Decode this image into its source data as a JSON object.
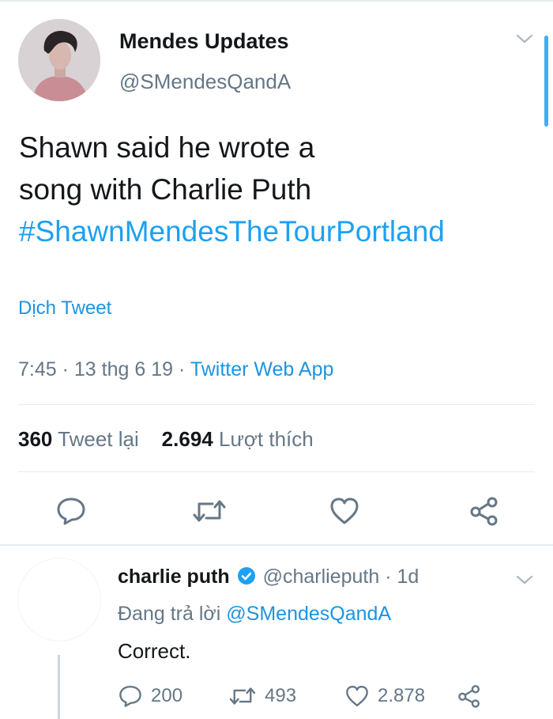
{
  "tweet": {
    "author_name": "Mendes Updates",
    "author_handle": "@SMendesQandA",
    "text_line1": "Shawn said he wrote a",
    "text_line2": "song with Charlie Puth",
    "hashtag": "#ShawnMendesTheTourPortland",
    "translate_label": "Dịch Tweet",
    "time": "7:45",
    "date": "13 thg 6 19",
    "separator": "·",
    "source": "Twitter Web App",
    "retweets_count": "360",
    "retweets_label": "Tweet lại",
    "likes_count": "2.694",
    "likes_label": "Lượt thích"
  },
  "reply": {
    "author_name": "charlie puth",
    "author_handle": "@charlieputh",
    "separator": "·",
    "time_ago": "1d",
    "replying_prefix": "Đang trả lời",
    "replying_to": "@SMendesQandA",
    "text": "Correct.",
    "reply_count": "200",
    "retweet_count": "493",
    "like_count": "2.878"
  },
  "icons": {
    "verified": "verified-badge-icon",
    "reply": "reply-icon",
    "retweet": "retweet-icon",
    "like": "heart-icon",
    "share": "share-icon",
    "menu": "chevron-down-icon"
  },
  "colors": {
    "accent": "#1da1f2",
    "text": "#14171a",
    "muted": "#657786",
    "divider": "#e6ecf0"
  }
}
